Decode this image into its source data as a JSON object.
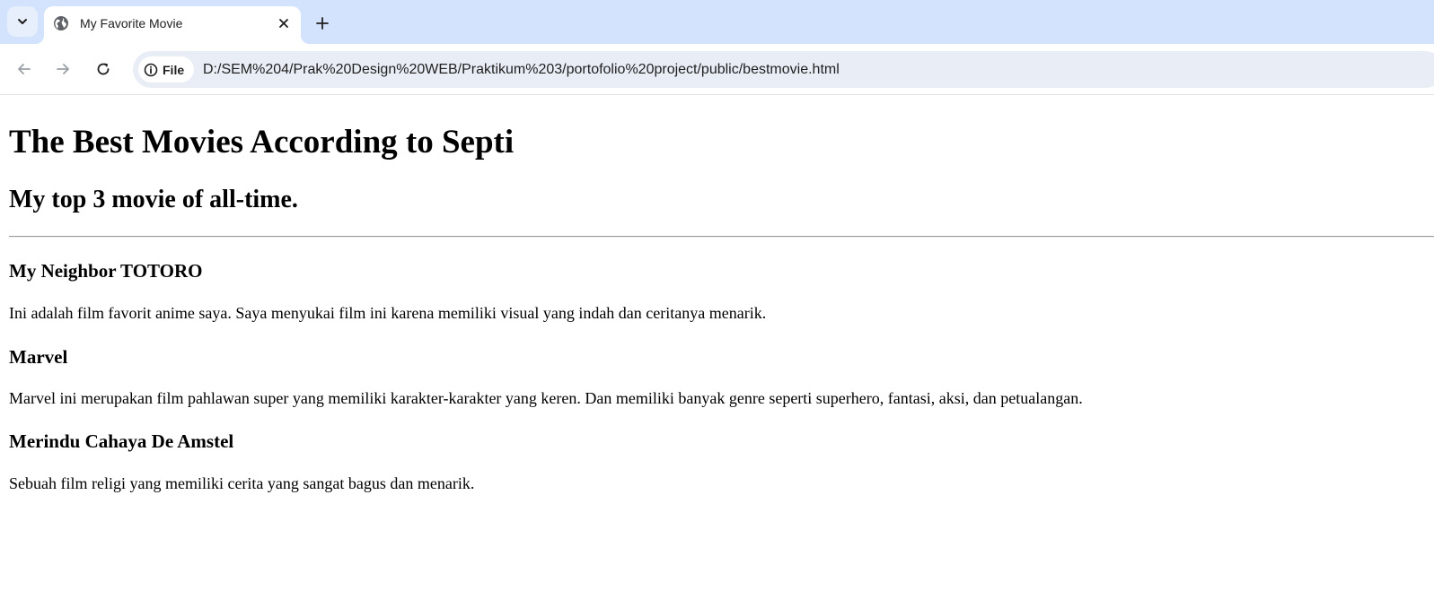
{
  "browser": {
    "tab": {
      "title": "My Favorite Movie",
      "favicon": "globe-icon",
      "close_icon": "close-icon"
    },
    "new_tab_icon": "plus-icon",
    "tab_search_icon": "chevron-down-icon",
    "nav": {
      "back_icon": "arrow-left-icon",
      "forward_icon": "arrow-right-icon",
      "reload_icon": "reload-icon"
    },
    "omnibox": {
      "site_info_icon": "info-icon",
      "site_chip_label": "File",
      "url": "D:/SEM%204/Prak%20Design%20WEB/Praktikum%203/portofolio%20project/public/bestmovie.html"
    },
    "colors": {
      "tabstrip_bg": "#d3e3fd",
      "omnibox_bg": "#e9eef6"
    }
  },
  "page": {
    "heading": "The Best Movies According to Septi",
    "subheading": "My top 3 movie of all-time.",
    "movies": [
      {
        "title": "My Neighbor TOTORO",
        "description": "Ini adalah film favorit anime saya. Saya menyukai film ini karena memiliki visual yang indah dan ceritanya menarik."
      },
      {
        "title": "Marvel",
        "description": "Marvel ini merupakan film pahlawan super yang memiliki karakter-karakter yang keren. Dan memiliki banyak genre seperti superhero, fantasi, aksi, dan petualangan."
      },
      {
        "title": "Merindu Cahaya De Amstel",
        "description": "Sebuah film religi yang memiliki cerita yang sangat bagus dan menarik."
      }
    ]
  }
}
